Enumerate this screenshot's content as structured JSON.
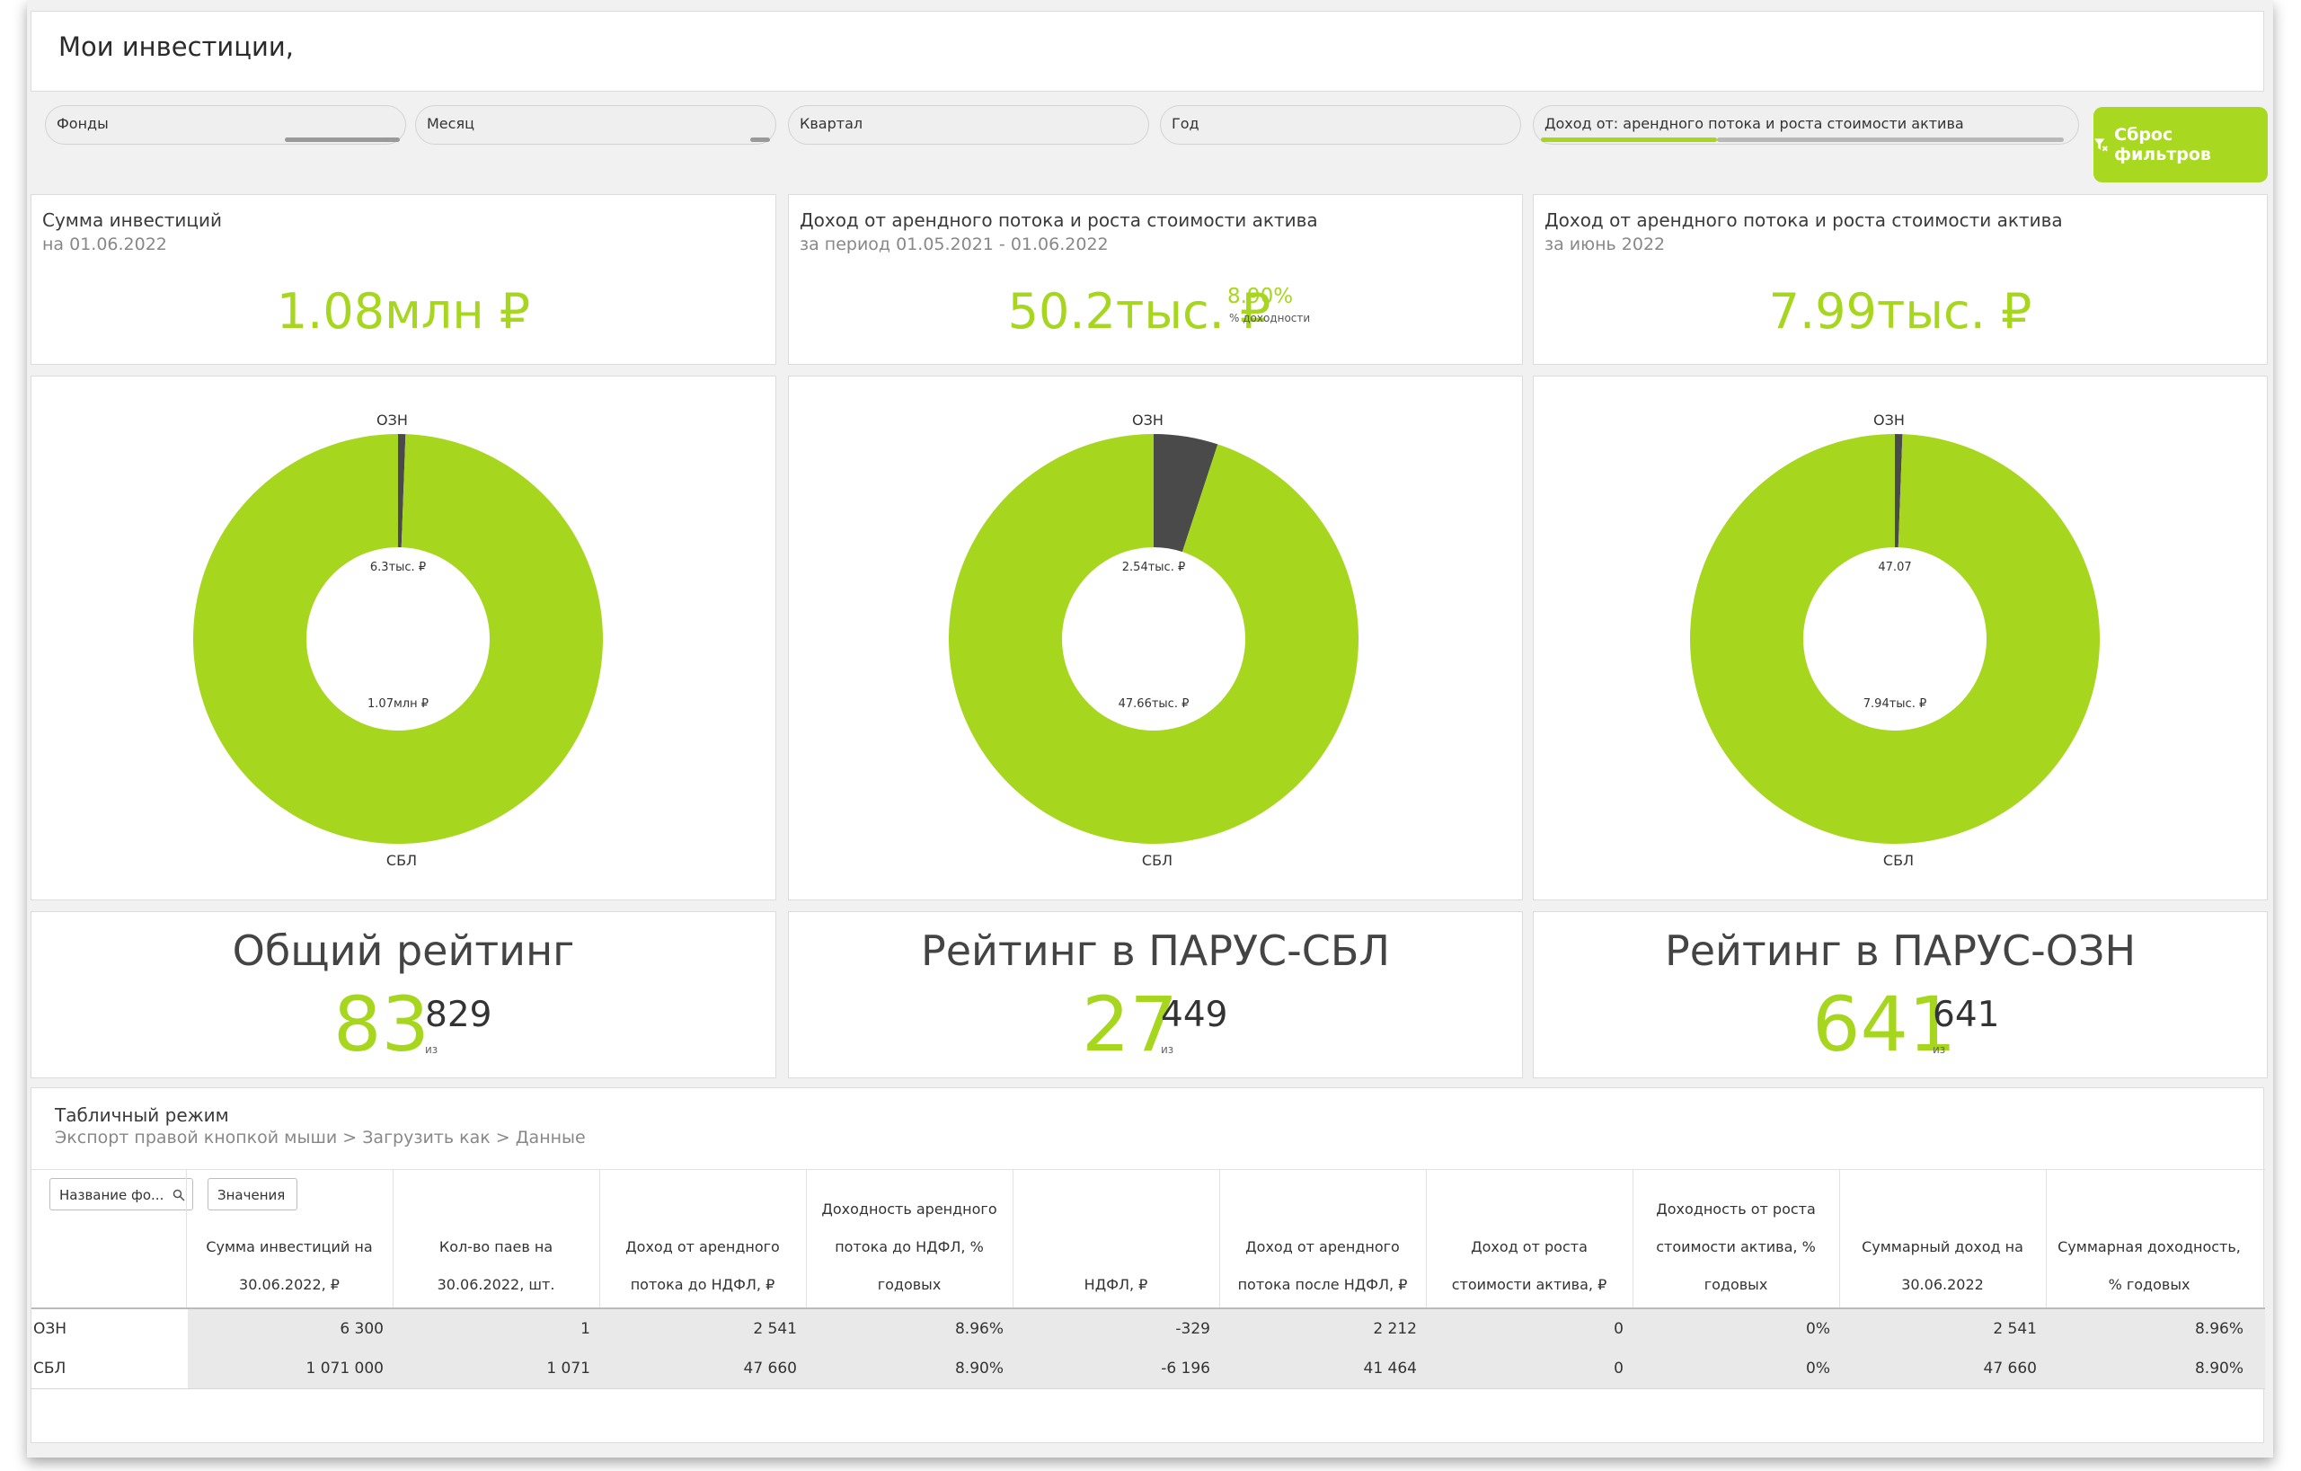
{
  "header": {
    "title": "Мои инвестиции,"
  },
  "filters": [
    {
      "label": "Фонды"
    },
    {
      "label": "Месяц"
    },
    {
      "label": "Квартал"
    },
    {
      "label": "Год"
    },
    {
      "label": "Доход от: арендного потока и роста стоимости актива"
    }
  ],
  "reset_button": {
    "icon": "filter-reset-icon",
    "label": "Сброс фильтров"
  },
  "kpi": [
    {
      "title": "Сумма инвестиций",
      "subtitle": "на 01.06.2022",
      "value": "1.08млн ₽"
    },
    {
      "title": "Доход от арендного потока и роста стоимости актива",
      "subtitle": "за период 01.05.2021 - 01.06.2022",
      "value": "50.2тыс. ₽",
      "pct": "8.90%",
      "pct_sub": "% доходности"
    },
    {
      "title": "Доход от арендного потока и роста стоимости актива",
      "subtitle": "за июнь 2022",
      "value": "7.99тыс. ₽"
    }
  ],
  "chart_data": [
    {
      "type": "pie",
      "categories": [
        "ОЗН",
        "СБЛ"
      ],
      "values": [
        6300,
        1071000
      ],
      "labels": [
        "6.3тыс. ₽",
        "1.07млн ₽"
      ],
      "colors": [
        "#4a4a4a",
        "#a6d61e"
      ]
    },
    {
      "type": "pie",
      "categories": [
        "ОЗН",
        "СБЛ"
      ],
      "values": [
        2541,
        47660
      ],
      "labels": [
        "2.54тыс. ₽",
        "47.66тыс. ₽"
      ],
      "colors": [
        "#4a4a4a",
        "#a6d61e"
      ]
    },
    {
      "type": "pie",
      "categories": [
        "ОЗН",
        "СБЛ"
      ],
      "values": [
        47.07,
        7940
      ],
      "labels": [
        "47.07",
        "7.94тыс. ₽"
      ],
      "colors": [
        "#4a4a4a",
        "#a6d61e"
      ]
    }
  ],
  "ratings": [
    {
      "title": "Общий рейтинг",
      "value": "83",
      "of": "829",
      "iz": "из"
    },
    {
      "title": "Рейтинг в ПАРУС-СБЛ",
      "value": "27",
      "of": "449",
      "iz": "из"
    },
    {
      "title": "Рейтинг в ПАРУС-ОЗН",
      "value": "641",
      "of": "641",
      "iz": "из"
    }
  ],
  "table": {
    "title": "Табличный режим",
    "subtitle": "Экспорт правой кнопкой мыши > Загрузить как > Данные",
    "name_chip": "Название фо...",
    "values_chip": "Значения",
    "columns": [
      [
        "Сумма инвестиций на",
        "30.06.2022, ₽"
      ],
      [
        "Кол-во паев на",
        "30.06.2022, шт."
      ],
      [
        "Доход от арендного",
        "потока до НДФЛ, ₽"
      ],
      [
        "Доходность арендного",
        "потока до НДФЛ, %",
        "годовых"
      ],
      [
        "НДФЛ, ₽"
      ],
      [
        "Доход от арендного",
        "потока после НДФЛ, ₽"
      ],
      [
        "Доход от роста",
        "стоимости актива, ₽"
      ],
      [
        "Доходность от роста",
        "стоимости актива, %",
        "годовых"
      ],
      [
        "Суммарный доход на",
        "30.06.2022"
      ],
      [
        "Суммарная доходность,",
        "% годовых"
      ]
    ],
    "rows": [
      {
        "name": "ОЗН",
        "cells": [
          "6 300",
          "1",
          "2 541",
          "8.96%",
          "-329",
          "2 212",
          "0",
          "0%",
          "2 541",
          "8.96%"
        ]
      },
      {
        "name": "СБЛ",
        "cells": [
          "1 071 000",
          "1 071",
          "47 660",
          "8.90%",
          "-6 196",
          "41 464",
          "0",
          "0%",
          "47 660",
          "8.90%"
        ]
      }
    ]
  }
}
